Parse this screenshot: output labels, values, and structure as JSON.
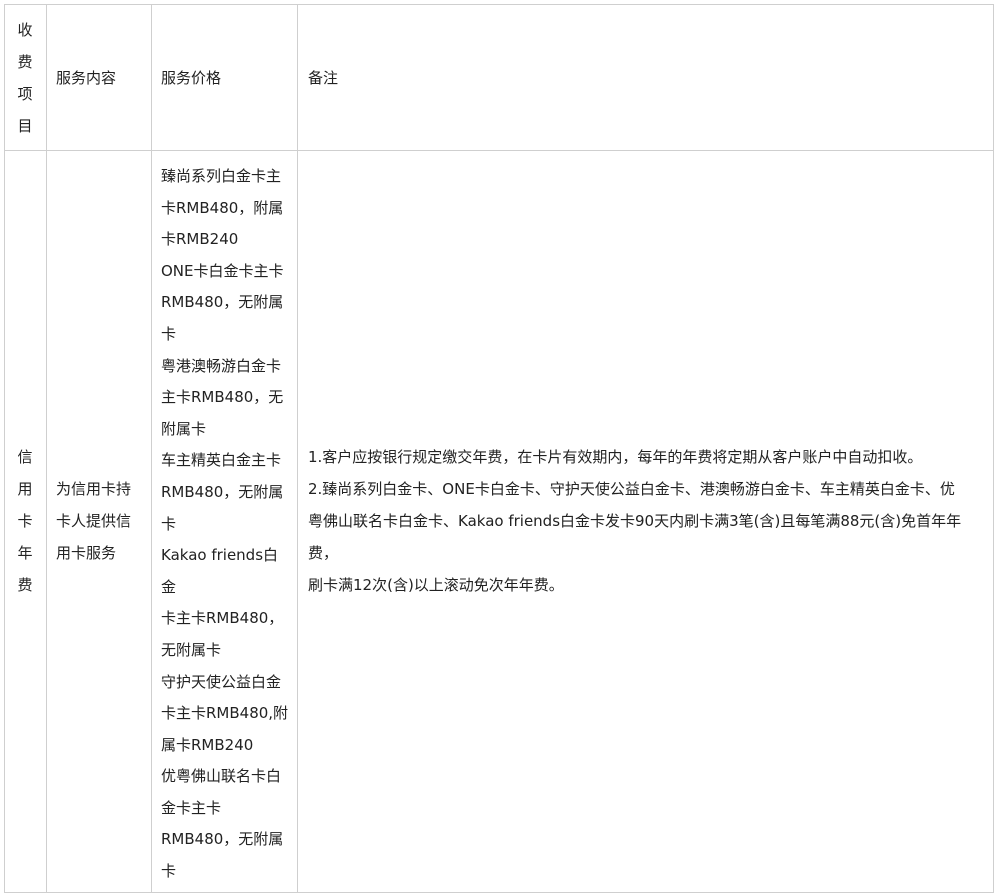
{
  "table": {
    "headers": {
      "item": "收费项目",
      "content": "服务内容",
      "price": "服务价格",
      "notes": "备注"
    },
    "row": {
      "item": "信用卡年费",
      "content": "为信用卡持卡人提供信用卡服务",
      "price_lines": [
        "臻尚系列白金卡主",
        "卡RMB480，附属",
        "卡RMB240",
        "ONE卡白金卡主卡",
        "RMB480，无附属",
        "卡",
        "粤港澳畅游白金卡",
        "主卡RMB480，无",
        "附属卡",
        "车主精英白金主卡",
        "RMB480，无附属",
        "卡",
        "Kakao friends白金",
        "卡主卡RMB480，",
        "无附属卡",
        "守护天使公益白金",
        "卡主卡RMB480,附",
        "属卡RMB240",
        "优粤佛山联名卡白",
        "金卡主卡",
        "RMB480，无附属",
        "卡"
      ],
      "notes_lines": [
        "1.客户应按银行规定缴交年费，在卡片有效期内，每年的年费将定期从客户账户中自动扣收。",
        "2.臻尚系列白金卡、ONE卡白金卡、守护天使公益白金卡、港澳畅游白金卡、车主精英白金卡、优",
        "粤佛山联名卡白金卡、Kakao friends白金卡发卡90天内刷卡满3笔(含)且每笔满88元(含)免首年年费，",
        "刷卡满12次(含)以上滚动免次年年费。"
      ]
    }
  }
}
